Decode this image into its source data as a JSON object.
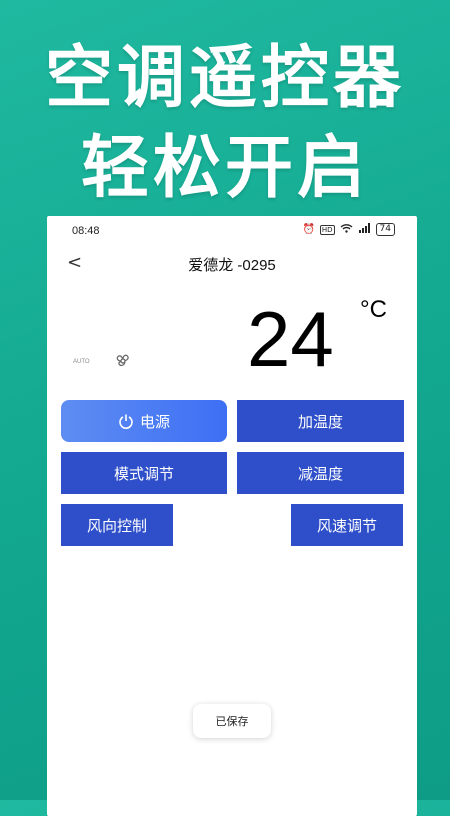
{
  "promo": {
    "line1": "空调遥控器",
    "line2": "轻松开启"
  },
  "status_bar": {
    "time": "08:48",
    "icons": [
      "alarm-icon",
      "hd-icon",
      "wifi-icon",
      "signal-icon"
    ],
    "battery": "74"
  },
  "nav": {
    "back_icon": "chevron-left-icon",
    "back_glyph": "<",
    "title": "爱德龙 -0295"
  },
  "display": {
    "temperature": "24",
    "unit": "°C",
    "mode": "AUTO",
    "fan_icon": "fan-icon"
  },
  "buttons": {
    "power": "电源",
    "power_icon": "power-icon",
    "heat": "加温度",
    "mode": "模式调节",
    "cool": "减温度",
    "direction": "风向控制",
    "speed": "风速调节"
  },
  "toast": {
    "text": "已保存"
  },
  "colors": {
    "background": "#15ad94",
    "button": "#2e4fc9",
    "power_button": "#4f7ef3"
  }
}
